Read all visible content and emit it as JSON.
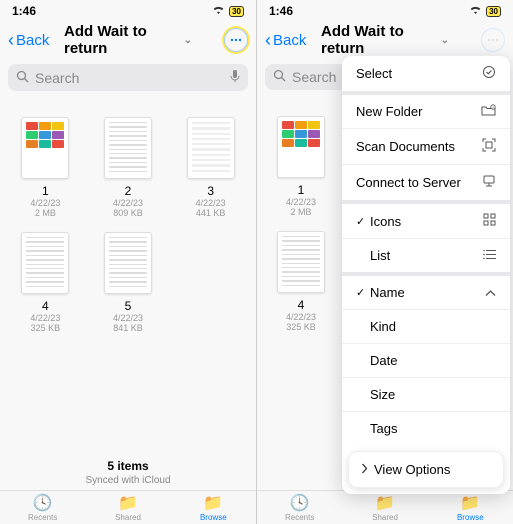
{
  "status": {
    "time": "1:46",
    "battery": "30"
  },
  "nav": {
    "back": "Back",
    "title": "Add Wait to return"
  },
  "search": {
    "placeholder": "Search"
  },
  "files": [
    {
      "name": "1",
      "date": "4/22/23",
      "size": "2 MB",
      "thumb": "colorful"
    },
    {
      "name": "2",
      "date": "4/22/23",
      "size": "809 KB",
      "thumb": "text"
    },
    {
      "name": "3",
      "date": "4/22/23",
      "size": "441 KB",
      "thumb": "table"
    },
    {
      "name": "4",
      "date": "4/22/23",
      "size": "325 KB",
      "thumb": "text"
    },
    {
      "name": "5",
      "date": "4/22/23",
      "size": "841 KB",
      "thumb": "text"
    }
  ],
  "footer": {
    "count": "5 items",
    "sync": "Synced with iCloud"
  },
  "tabs": [
    {
      "label": "Recents"
    },
    {
      "label": "Shared"
    },
    {
      "label": "Browse"
    }
  ],
  "menu": {
    "select": "Select",
    "new_folder": "New Folder",
    "scan": "Scan Documents",
    "connect": "Connect to Server",
    "icons": "Icons",
    "list": "List",
    "name": "Name",
    "kind": "Kind",
    "date": "Date",
    "size": "Size",
    "tags": "Tags",
    "view_options": "View Options"
  },
  "thumb_colors": {
    "r1": [
      "#e74c3c",
      "#f39c12",
      "#f1c40f"
    ],
    "r2": [
      "#2ecc71",
      "#3498db",
      "#9b59b6"
    ],
    "r3": [
      "#e67e22",
      "#1abc9c",
      "#e74c3c"
    ]
  }
}
